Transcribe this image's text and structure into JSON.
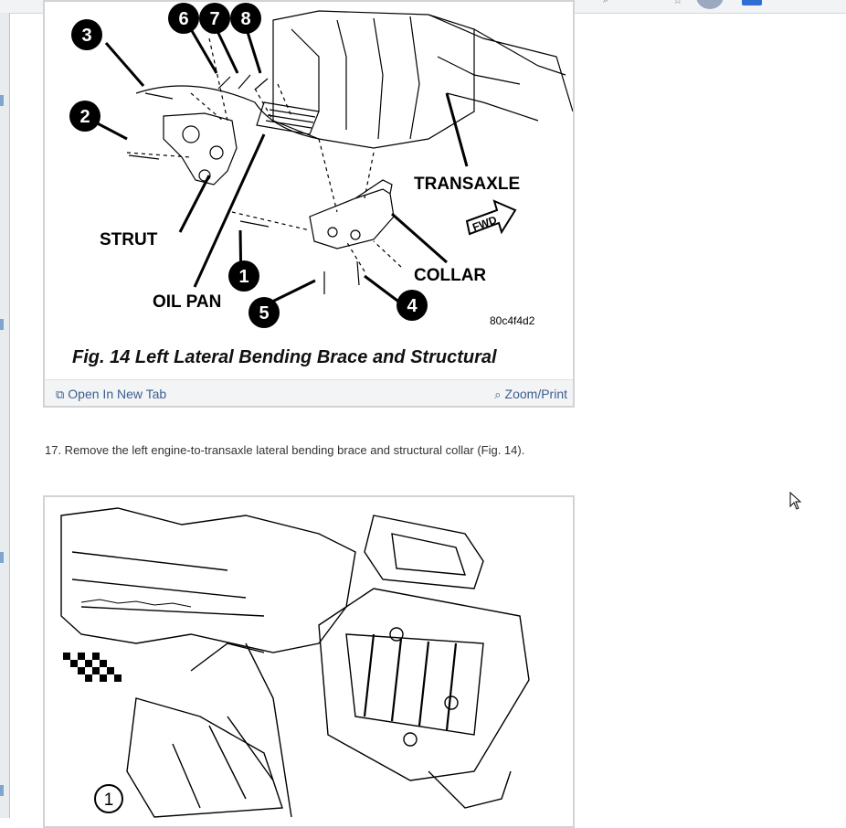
{
  "figure14": {
    "caption": "Fig. 14 Left Lateral Bending Brace and Structural",
    "image_code": "80c4f4d2",
    "labels": {
      "transaxle": "TRANSAXLE",
      "strut": "STRUT",
      "oil_pan": "OIL PAN",
      "collar": "COLLAR",
      "fwd": "FWD"
    },
    "callouts": [
      "1",
      "2",
      "3",
      "4",
      "5",
      "6",
      "7",
      "8"
    ],
    "open_new_tab": "Open In New Tab",
    "zoom_print": "Zoom/Print"
  },
  "step": {
    "text": "17. Remove the left engine-to-transaxle lateral bending brace and structural collar (Fig. 14)."
  },
  "figure15": {
    "callouts": [
      "1"
    ]
  },
  "icons": {
    "open_tab": "open-in-new-tab-icon",
    "zoom": "magnifier-icon",
    "cursor": "mouse-cursor-icon"
  },
  "colors": {
    "link": "#3b5f8f",
    "footer_bg": "#f3f4f6",
    "border": "#d3d3d3"
  }
}
